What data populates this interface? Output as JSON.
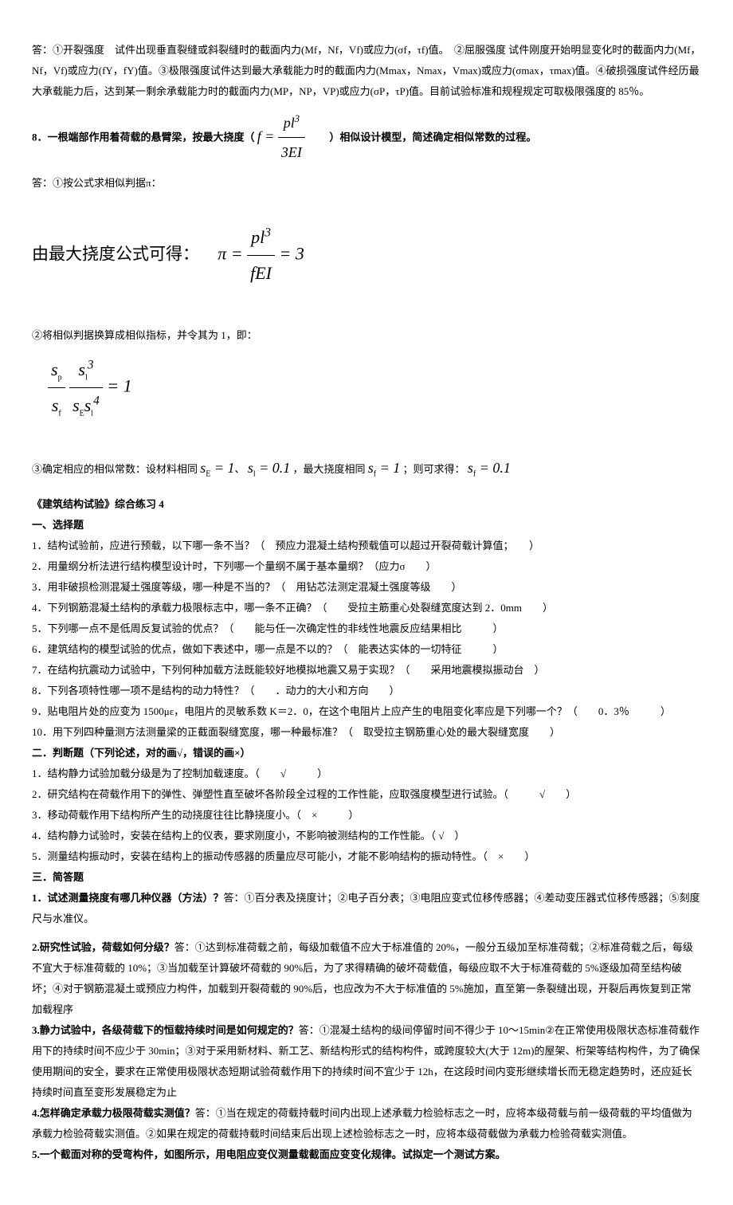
{
  "p1": "答：①开裂强度　试件出现垂直裂缝或斜裂缝时的截面内力(Mf，Nf，Vf)或应力(σf，τf)值。　②屈服强度 试件刚度开始明显变化时的截面内力(Mf，Nf，Vf)或应力(fY，fY)值。③极限强度试件达到最大承载能力时的截面内力(Mmax，Nmax，Vmax)或应力(σmax，τmax)值。④破损强度试件经历最大承载能力后，达到某一剩余承载能力时的截面内力(MP，NP，VP)或应力(σP，τP)值。目前试验标准和规程规定可取极限强度的 85％。",
  "q8_pre": "8．一根端部作用着荷载的悬臂梁，按最大挠度（",
  "q8_post": "　　）相似设计模型，简述确定相似常数的过程。",
  "a8_1": "答：①按公式求相似判据π：",
  "a8_2_pre": "由最大挠度公式可得：",
  "a8_3": "②将相似判据换算成相似指标，并令其为 1，即：",
  "a8_5_pre": "③确定相应的相似常数：设材料相同",
  "a8_5_mid1": "，最大挠度相同",
  "a8_5_mid2": "；则可求得：",
  "header4": "《建筑结构试验》综合练习 4",
  "sec1_title": "一、选择题",
  "sec1_q1": "1．结构试验前，应进行预载，以下哪一条不当？（　预应力混凝土结构预载值可以超过开裂荷载计算值；　　）",
  "sec1_q2": "2．用量纲分析法进行结构模型设计时，下列哪一个量纲不属于基本量纲？（应力σ　　）",
  "sec1_q3": "3．用非破损检测混凝土强度等级，哪一种是不当的？（　用钻芯法测定混凝土强度等级　　）",
  "sec1_q4": "4．下列钢筋混凝土结构的承载力极限标志中，哪一条不正确？（　　受拉主筋重心处裂缝宽度达到 2．0mm　　）",
  "sec1_q5": "5．下列哪一点不是低周反复试验的优点？（　　能与任一次确定性的非线性地震反应结果相比　　　）",
  "sec1_q6": "6．建筑结构的模型试验的优点，做如下表述中，哪一点是不以的？（　能表达实体的一切特征　　　）",
  "sec1_q7": "7．在结构抗震动力试验中，下列何种加载方法既能较好地模拟地震又易于实现？（　　采用地震模拟振动台　）",
  "sec1_q8": "8．下列各项特性哪一项不是结构的动力特性？（　　．动力的大小和方向　　）",
  "sec1_q9": "9．贴电阻片处的应变为 1500με，电阻片的灵敏系数 K＝2．0，在这个电阻片上应产生的电阻变化率应是下列哪一个？（　　0．3％　　　）",
  "sec1_q10": "10．用下列四种量测方法测量梁的正截面裂缝宽度，哪一种最标准？（　取受拉主钢筋重心处的最大裂缝宽度　　）",
  "sec2_title": "二．判断题（下列论述，对的画√，错误的画×）",
  "sec2_q1": "1．结构静力试验加载分级是为了控制加载速度。（　　√　　　）",
  "sec2_q2": "2．研究结构在荷载作用下的弹性、弹塑性直至破坏各阶段全过程的工作性能，应取强度模型进行试验。（　　　√　　）",
  "sec2_q3": "3．移动荷载作用下结构所产生的动挠度往往比静挠度小。（　×　　　）",
  "sec2_q4": "4．结构静力试验时，安装在结构上的仪表，要求刚度小，不影响被测结构的工作性能。（ √　）",
  "sec2_q5": "5．测量结构振动时，安装在结构上的振动传感器的质量应尽可能小，才能不影响结构的振动特性。（　×　　）",
  "sec3_title": "三．简答题",
  "sec3_q1_t": "1．试述测量挠度有哪几种仪器（方法）？",
  "sec3_q1_a": "答：①百分表及挠度计；②电子百分表；③电阻应变式位移传感器；④差动变压器式位移传感器；⑤刻度尺与水准仪。",
  "sec3_q2_t": "2.研究性试验，荷载如何分级？",
  "sec3_q2_a": "答：①达到标准荷载之前，每级加载值不应大于标准值的 20%，一般分五级加至标准荷载；②标准荷载之后，每级不宜大于标准荷载的 10%；③当加载至计算破坏荷载的 90%后，为了求得精确的破坏荷载值，每级应取不大于标准荷载的 5%逐级加荷至结构破坏；④对于钢筋混凝土或预应力构件，加载到开裂荷载的 90%后，也应改为不大于标准值的 5%施加，直至第一条裂缝出现，开裂后再恢复到正常加载程序",
  "sec3_q3_t": "3.静力试验中，各级荷载下的恒载持续时间是如何规定的？",
  "sec3_q3_a": "答：①混凝土结构的级间停留时间不得少于 10～15min②在正常使用极限状态标准荷载作用下的持续时间不应少于 30min；③对于采用新材料、新工艺、新结构形式的结构构件，或跨度较大(大于 12m)的屋架、桁架等结构构件，为了确保使用期间的安全，要求在正常使用极限状态短期试验荷载作用下的持续时间不宜少于 12h，在这段时间内变形继续增长而无稳定趋势时，还应延长持续时间直至变形发展稳定为止",
  "sec3_q4_t": "4.怎样确定承载力极限荷载实测值？",
  "sec3_q4_a": "答：①当在规定的荷载持载时间内出现上述承载力检验标志之一时，应将本级荷载与前一级荷载的平均值做为承载力检验荷载实测值。②如果在规定的荷载持载时间结束后出现上述检验标志之一时，应将本级荷载做为承载力检验荷载实测值。",
  "sec3_q5_t": "5.一个截面对称的受弯构件，如图所示，用电阻应变仪测量载截面应变变化规律。试拟定一个测试方案。"
}
